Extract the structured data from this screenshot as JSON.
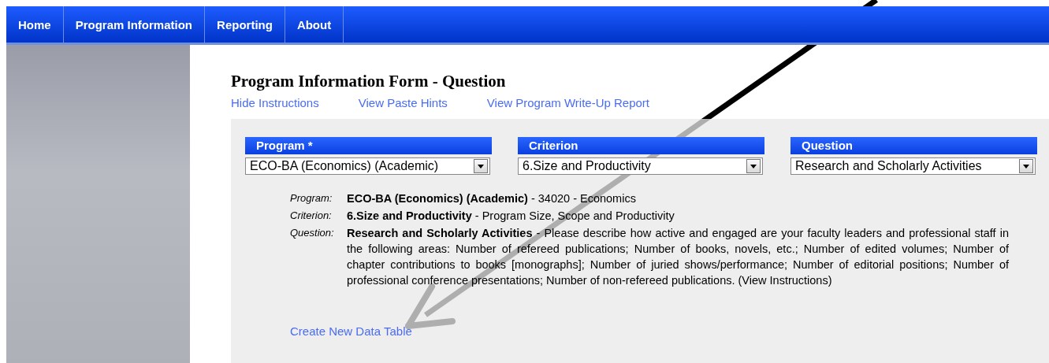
{
  "nav": [
    {
      "label": "Home"
    },
    {
      "label": "Program Information"
    },
    {
      "label": "Reporting"
    },
    {
      "label": "About"
    }
  ],
  "page": {
    "title": "Program Information Form - Question",
    "links": [
      "Hide Instructions",
      "View Paste Hints",
      "View Program Write-Up Report"
    ]
  },
  "selectors": [
    {
      "label": "Program *",
      "value": "ECO-BA (Economics) (Academic)"
    },
    {
      "label": "Criterion",
      "value": "6.Size and Productivity"
    },
    {
      "label": "Question",
      "value": "Research and Scholarly Activities"
    }
  ],
  "details": [
    {
      "label": "Program:",
      "text": "**ECO-BA (Economics) (Academic)** - 34020 - Economics"
    },
    {
      "label": "Criterion:",
      "text": "**6.Size and Productivity** - Program Size, Scope and Productivity"
    },
    {
      "label": "Question:",
      "text": "**Research and Scholarly Activities** - Please describe how active and engaged are your faculty leaders and professional staff in the following areas: Number of refereed publications; Number of books, novels, etc.; Number of edited volumes; Number of chapter contributions to books [monographs]; Number of juried shows/performance; Number of editorial positions; Number of professional conference presentations; Number of non-refereed publications. (View Instructions)"
    }
  ],
  "action_link": "Create New Data Table"
}
